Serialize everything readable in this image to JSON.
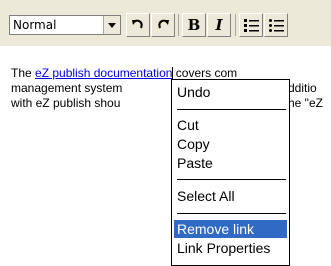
{
  "toolbar": {
    "style_value": "Normal",
    "buttons": {
      "bold": "B",
      "italic": "I"
    }
  },
  "content": {
    "line1_prefix": "The ",
    "line1_link": "eZ publish documentation",
    "line1_suffix": " covers com",
    "line2": "management system",
    "line2_right": "dditio",
    "line3": "with eZ publish shou",
    "line3_right": "he \"eZ"
  },
  "context_menu": {
    "items": [
      "Undo",
      "Cut",
      "Copy",
      "Paste",
      "Select All",
      "Remove link",
      "Link Properties"
    ],
    "selected": "Remove link",
    "selected_color": "#316ac5"
  }
}
